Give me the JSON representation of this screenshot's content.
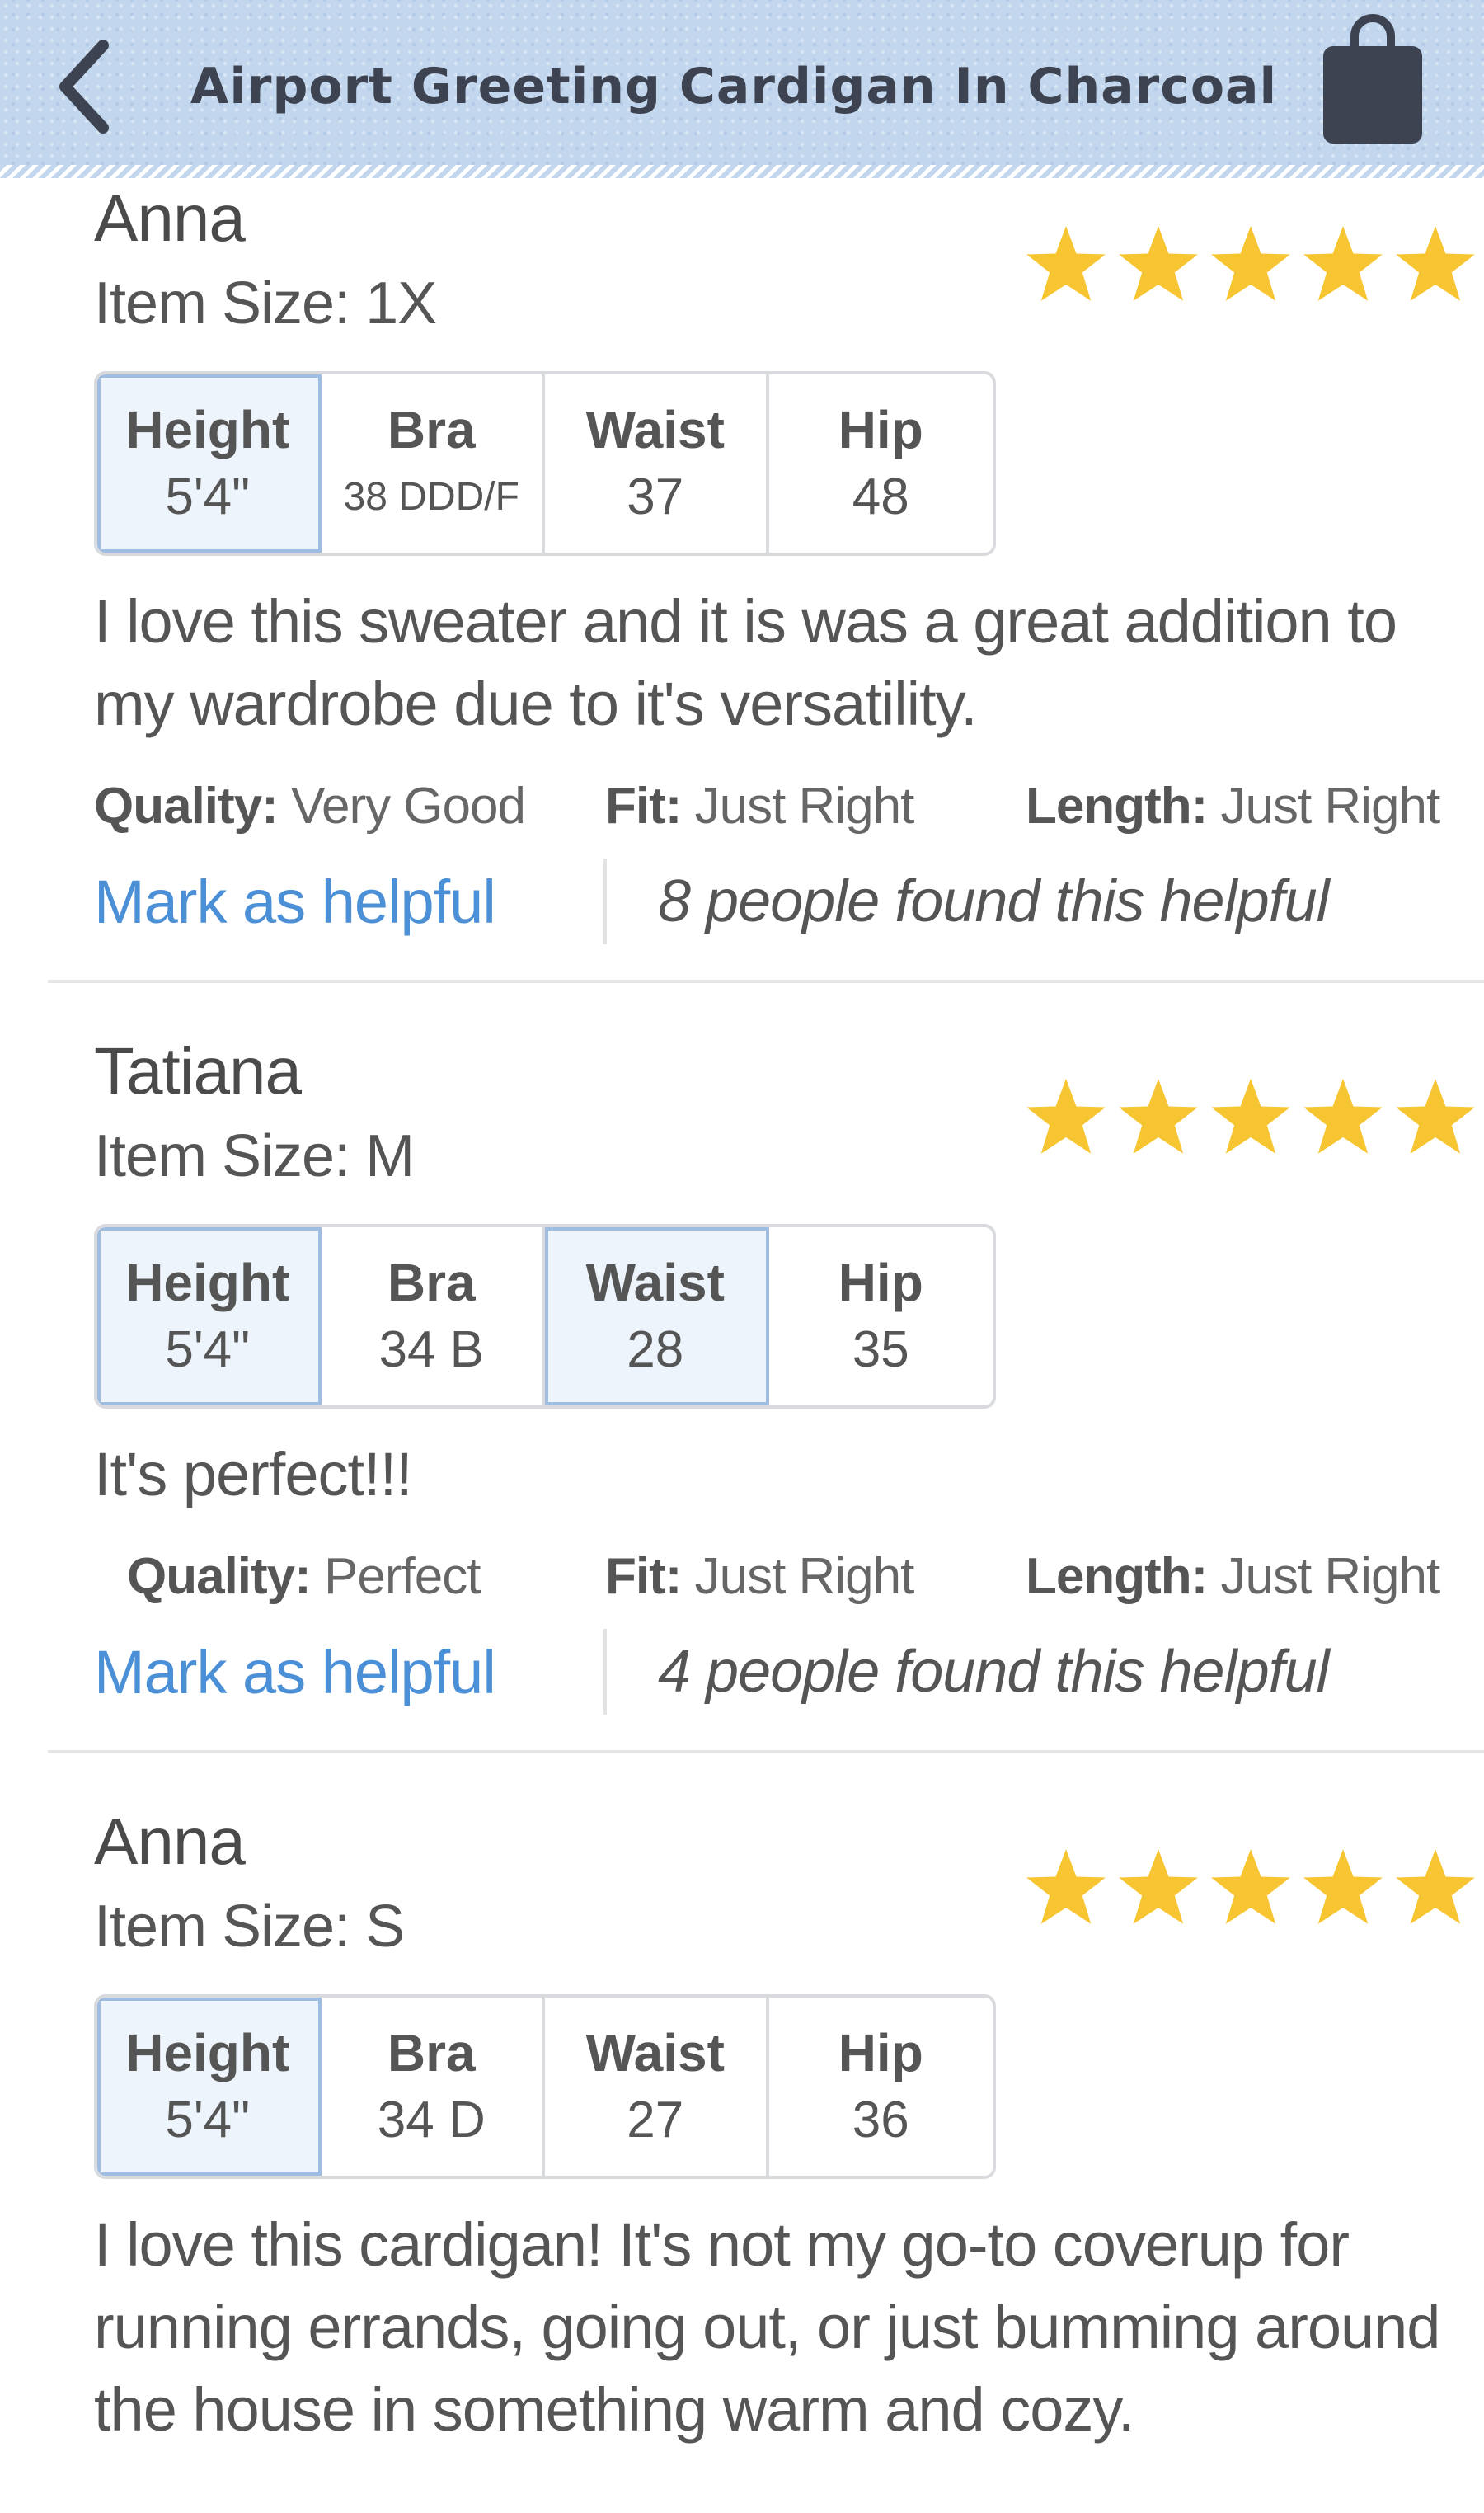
{
  "header": {
    "title": "Airport Greeting Cardigan In Charcoal",
    "back_icon": "chevron-left-icon",
    "bag_icon": "shopping-bag-icon",
    "background_color": "#c2d6ee"
  },
  "colors": {
    "star": "#f7c531",
    "link": "#4b8fd6",
    "highlight_border": "#9fbde0"
  },
  "reviews": [
    {
      "name": "Anna",
      "item_size": "Item Size: 1X",
      "rating": 5,
      "measurements": [
        {
          "label": "Height",
          "value": "5'4\"",
          "highlighted": true
        },
        {
          "label": "Bra",
          "value": "38 DDD/F",
          "highlighted": false
        },
        {
          "label": "Waist",
          "value": "37",
          "highlighted": false
        },
        {
          "label": "Hip",
          "value": "48",
          "highlighted": false
        }
      ],
      "text": "I love this sweater and it is was a great addition to my wardrobe due to it's versatility.",
      "quality_label": "Quality:",
      "quality_value": "Very Good",
      "fit_label": "Fit:",
      "fit_value": "Just Right",
      "length_label": "Length:",
      "length_value": "Just Right",
      "helpful_link": "Mark as helpful",
      "helpful_count": "8 people found this helpful"
    },
    {
      "name": "Tatiana",
      "item_size": "Item Size: M",
      "rating": 5,
      "measurements": [
        {
          "label": "Height",
          "value": "5'4\"",
          "highlighted": true
        },
        {
          "label": "Bra",
          "value": "34 B",
          "highlighted": false
        },
        {
          "label": "Waist",
          "value": "28",
          "highlighted": true
        },
        {
          "label": "Hip",
          "value": "35",
          "highlighted": false
        }
      ],
      "text": "It's perfect!!!",
      "quality_label": "Quality:",
      "quality_value": "Perfect",
      "fit_label": "Fit:",
      "fit_value": "Just Right",
      "length_label": "Length:",
      "length_value": "Just Right",
      "helpful_link": "Mark as helpful",
      "helpful_count": "4 people found this helpful"
    },
    {
      "name": "Anna",
      "item_size": "Item Size: S",
      "rating": 5,
      "measurements": [
        {
          "label": "Height",
          "value": "5'4\"",
          "highlighted": true
        },
        {
          "label": "Bra",
          "value": "34 D",
          "highlighted": false
        },
        {
          "label": "Waist",
          "value": "27",
          "highlighted": false
        },
        {
          "label": "Hip",
          "value": "36",
          "highlighted": false
        }
      ],
      "text": "I love this cardigan! It's not my go-to coverup for running errands, going out, or just bumming around the house in something warm and cozy."
    }
  ]
}
